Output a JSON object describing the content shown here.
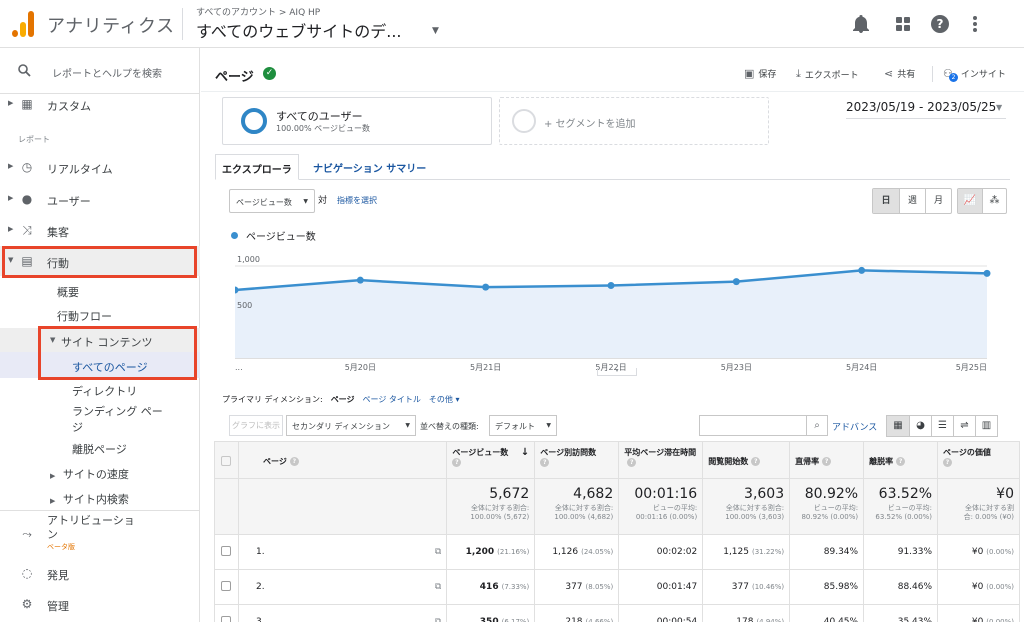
{
  "header": {
    "app_name": "アナリティクス",
    "account_path": "すべてのアカウント > AIQ HP",
    "view_title": "すべてのウェブサイトのデ..."
  },
  "sidebar": {
    "search_placeholder": "レポートとヘルプを検索",
    "custom": "カスタム",
    "section_reports": "レポート",
    "realtime": "リアルタイム",
    "users": "ユーザー",
    "acquisition": "集客",
    "behavior": "行動",
    "overview": "概要",
    "behavior_flow": "行動フロー",
    "site_content": "サイト コンテンツ",
    "all_pages": "すべてのページ",
    "directory": "ディレクトリ",
    "landing_pages_1": "ランディング ペー",
    "landing_pages_2": "ジ",
    "exit_pages": "離脱ページ",
    "site_speed": "サイトの速度",
    "site_search": "サイト内検索",
    "attribution_1": "アトリビューショ",
    "attribution_2": "ン",
    "beta": "ベータ版",
    "discover": "発見",
    "admin": "管理"
  },
  "page": {
    "title": "ページ",
    "save": "保存",
    "export": "エクスポート",
    "share": "共有",
    "insights": "インサイト",
    "insights_badge": "2"
  },
  "segments": {
    "all_users": "すべてのユーザー",
    "all_users_sub": "100.00% ページビュー数",
    "add_segment": "+ セグメントを追加"
  },
  "date_range": "2023/05/19 - 2023/05/25",
  "tabs": {
    "explorer": "エクスプローラ",
    "nav_summary": "ナビゲーション サマリー"
  },
  "chart_controls": {
    "metric": "ページビュー数",
    "vs": "対",
    "select_metric": "指標を選択",
    "day": "日",
    "week": "週",
    "month": "月"
  },
  "chart_data": {
    "type": "area",
    "series": [
      {
        "name": "ページビュー数",
        "values": [
          739,
          846,
          770,
          788,
          830,
          952,
          920
        ]
      }
    ],
    "x": [
      "5/19",
      "5/20",
      "5/21",
      "5/22",
      "5/23",
      "5/24",
      "5/25"
    ],
    "x_tick_labels": [
      "...",
      "5月20日",
      "5月21日",
      "5月22日",
      "5月23日",
      "5月24日",
      "5月25日"
    ],
    "y_tick_labels": [
      "1,000",
      "500"
    ],
    "ylim": [
      0,
      1000
    ],
    "color": "#3a8fcf",
    "fill": "#e8f0fa"
  },
  "dimension": {
    "label": "プライマリ ディメンション:",
    "page": "ページ",
    "page_title": "ページ タイトル",
    "other": "その他"
  },
  "table_controls": {
    "graph_btn": "グラフに表示",
    "secondary_dim": "セカンダリ ディメンション",
    "sort_type": "並べ替えの種類:",
    "default": "デフォルト",
    "advanced": "アドバンス"
  },
  "table": {
    "headers": [
      "ページ",
      "ページビュー数",
      "ページ別訪問数",
      "平均ページ滞在時間",
      "閲覧開始数",
      "直帰率",
      "離脱率",
      "ページの価値"
    ],
    "totals": [
      {
        "big": "5,672",
        "small1": "全体に対する割合:",
        "small2": "100.00% (5,672)"
      },
      {
        "big": "4,682",
        "small1": "全体に対する割合:",
        "small2": "100.00% (4,682)"
      },
      {
        "big": "00:01:16",
        "small1": "ビューの平均:",
        "small2": "00:01:16 (0.00%)"
      },
      {
        "big": "3,603",
        "small1": "全体に対する割合:",
        "small2": "100.00% (3,603)"
      },
      {
        "big": "80.92%",
        "small1": "ビューの平均:",
        "small2": "80.92% (0.00%)"
      },
      {
        "big": "63.52%",
        "small1": "ビューの平均:",
        "small2": "63.52% (0.00%)"
      },
      {
        "big": "¥0",
        "small1": "全体に対する割",
        "small2": "合: 0.00% (¥0)"
      }
    ],
    "rows": [
      {
        "idx": "1.",
        "pv": "1,200",
        "pv_pct": "(21.16%)",
        "upv": "1,126",
        "upv_pct": "(24.05%)",
        "time": "00:02:02",
        "ent": "1,125",
        "ent_pct": "(31.22%)",
        "bounce": "89.34%",
        "exit": "91.33%",
        "val": "¥0",
        "val_pct": "(0.00%)"
      },
      {
        "idx": "2.",
        "pv": "416",
        "pv_pct": "(7.33%)",
        "upv": "377",
        "upv_pct": "(8.05%)",
        "time": "00:01:47",
        "ent": "377",
        "ent_pct": "(10.46%)",
        "bounce": "85.98%",
        "exit": "88.46%",
        "val": "¥0",
        "val_pct": "(0.00%)"
      },
      {
        "idx": "3.",
        "pv": "350",
        "pv_pct": "(6.17%)",
        "upv": "218",
        "upv_pct": "(4.66%)",
        "time": "00:00:54",
        "ent": "178",
        "ent_pct": "(4.94%)",
        "bounce": "40.45%",
        "exit": "35.43%",
        "val": "¥0",
        "val_pct": "(0.00%)"
      }
    ]
  }
}
